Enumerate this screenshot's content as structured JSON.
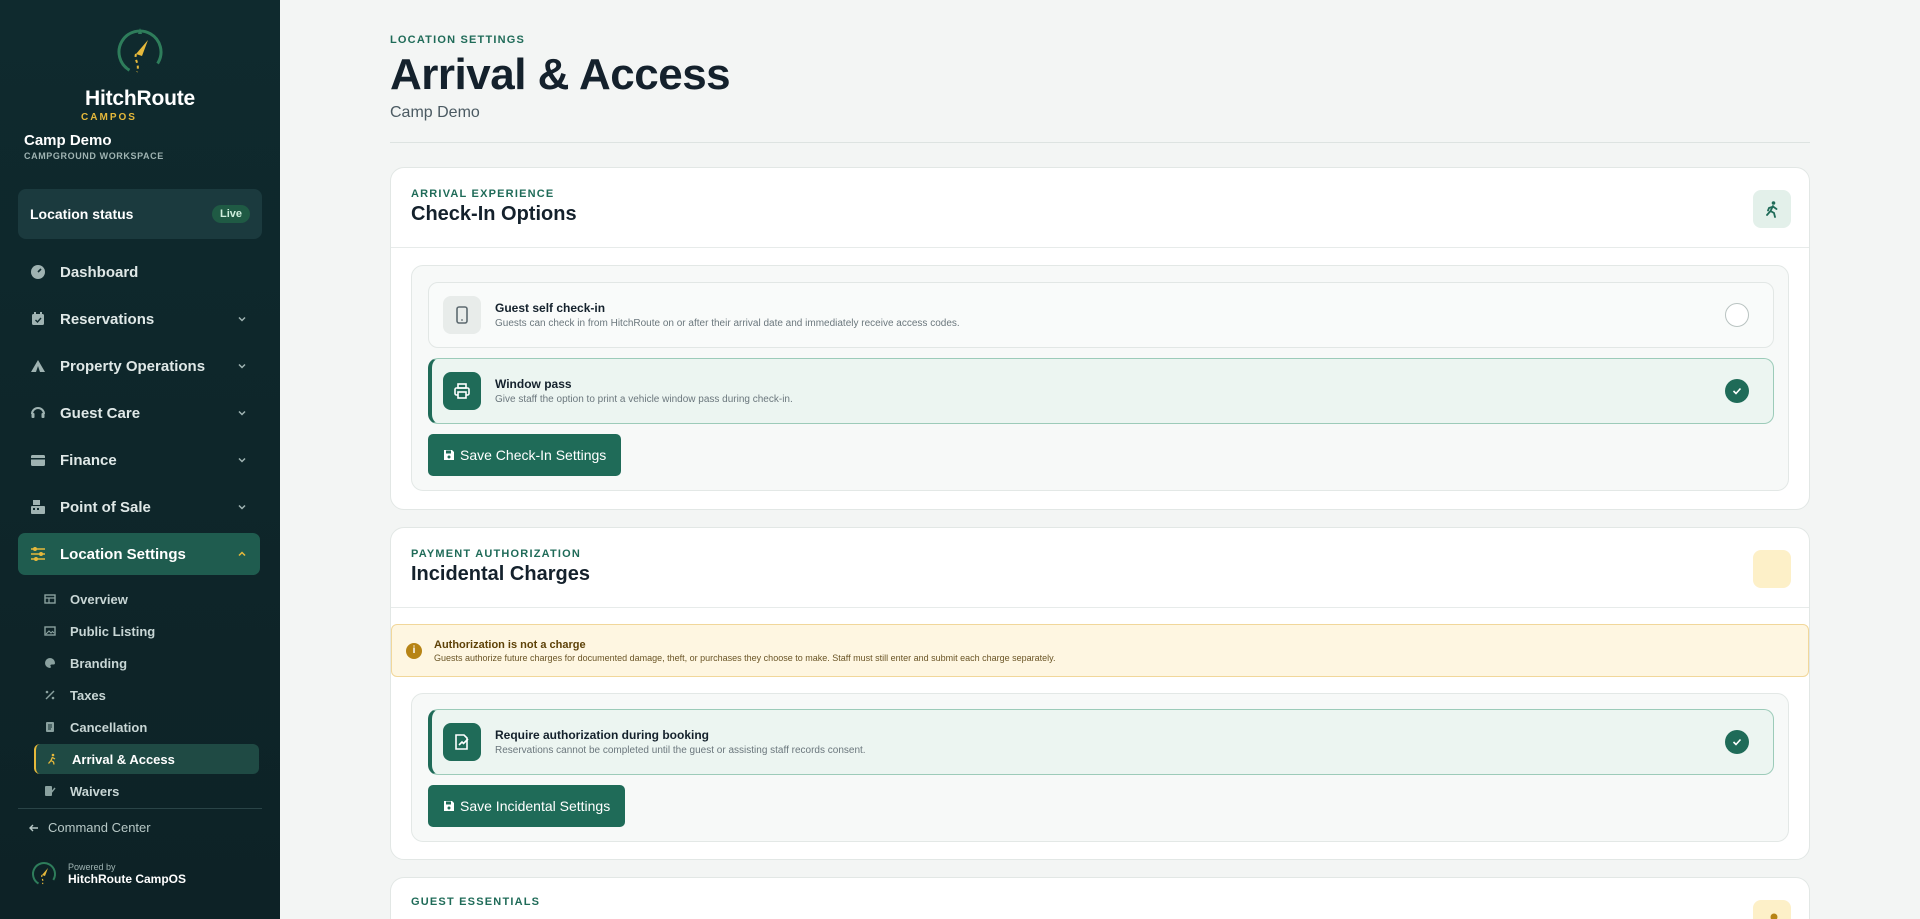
{
  "brand": {
    "name": "HitchRoute",
    "sub": "CAMPOS"
  },
  "workspace": {
    "name": "Camp Demo",
    "sub": "CAMPGROUND WORKSPACE"
  },
  "status": {
    "label": "Location status",
    "badge": "Live"
  },
  "nav": [
    {
      "label": "Dashboard",
      "icon": "gauge-icon"
    },
    {
      "label": "Reservations",
      "icon": "calendar-icon"
    },
    {
      "label": "Property Operations",
      "icon": "tent-icon"
    },
    {
      "label": "Guest Care",
      "icon": "headset-icon"
    },
    {
      "label": "Finance",
      "icon": "wallet-icon"
    },
    {
      "label": "Point of Sale",
      "icon": "register-icon"
    },
    {
      "label": "Location Settings",
      "icon": "sliders-icon"
    }
  ],
  "subnav": [
    {
      "label": "Overview"
    },
    {
      "label": "Public Listing"
    },
    {
      "label": "Branding"
    },
    {
      "label": "Taxes"
    },
    {
      "label": "Cancellation"
    },
    {
      "label": "Arrival & Access"
    },
    {
      "label": "Waivers"
    }
  ],
  "footer": {
    "command_center": "Command Center",
    "powered_by": "Powered by",
    "powered_name": "HitchRoute CampOS"
  },
  "page": {
    "eyebrow": "LOCATION SETTINGS",
    "title": "Arrival & Access",
    "subtitle": "Camp Demo"
  },
  "checkin": {
    "eyebrow": "ARRIVAL EXPERIENCE",
    "title": "Check-In Options",
    "options": [
      {
        "title": "Guest self check-in",
        "desc": "Guests can check in from HitchRoute on or after their arrival date and immediately receive access codes.",
        "enabled": false
      },
      {
        "title": "Window pass",
        "desc": "Give staff the option to print a vehicle window pass during check-in.",
        "enabled": true
      }
    ],
    "save_label": "Save Check-In Settings"
  },
  "incidental": {
    "eyebrow": "PAYMENT AUTHORIZATION",
    "title": "Incidental Charges",
    "alert_title": "Authorization is not a charge",
    "alert_desc": "Guests authorize future charges for documented damage, theft, or purchases they choose to make. Staff must still enter and submit each charge separately.",
    "option": {
      "title": "Require authorization during booking",
      "desc": "Reservations cannot be completed until the guest or assisting staff records consent.",
      "enabled": true
    },
    "save_label": "Save Incidental Settings"
  },
  "essentials": {
    "eyebrow": "GUEST ESSENTIALS"
  },
  "colors": {
    "primary": "#1f6b58",
    "sidebar": "#0f2a2e",
    "accent": "#e6b93b",
    "warning_bg": "#fef6e1"
  }
}
